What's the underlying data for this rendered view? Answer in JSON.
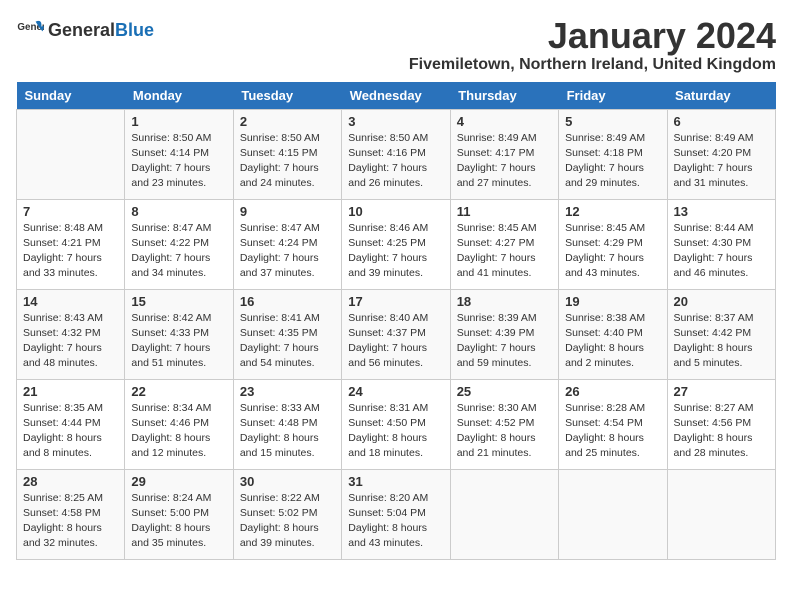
{
  "header": {
    "logo_general": "General",
    "logo_blue": "Blue",
    "month_title": "January 2024",
    "location": "Fivemiletown, Northern Ireland, United Kingdom"
  },
  "days_of_week": [
    "Sunday",
    "Monday",
    "Tuesday",
    "Wednesday",
    "Thursday",
    "Friday",
    "Saturday"
  ],
  "weeks": [
    [
      {
        "day": "",
        "info": ""
      },
      {
        "day": "1",
        "info": "Sunrise: 8:50 AM\nSunset: 4:14 PM\nDaylight: 7 hours\nand 23 minutes."
      },
      {
        "day": "2",
        "info": "Sunrise: 8:50 AM\nSunset: 4:15 PM\nDaylight: 7 hours\nand 24 minutes."
      },
      {
        "day": "3",
        "info": "Sunrise: 8:50 AM\nSunset: 4:16 PM\nDaylight: 7 hours\nand 26 minutes."
      },
      {
        "day": "4",
        "info": "Sunrise: 8:49 AM\nSunset: 4:17 PM\nDaylight: 7 hours\nand 27 minutes."
      },
      {
        "day": "5",
        "info": "Sunrise: 8:49 AM\nSunset: 4:18 PM\nDaylight: 7 hours\nand 29 minutes."
      },
      {
        "day": "6",
        "info": "Sunrise: 8:49 AM\nSunset: 4:20 PM\nDaylight: 7 hours\nand 31 minutes."
      }
    ],
    [
      {
        "day": "7",
        "info": "Sunrise: 8:48 AM\nSunset: 4:21 PM\nDaylight: 7 hours\nand 33 minutes."
      },
      {
        "day": "8",
        "info": "Sunrise: 8:47 AM\nSunset: 4:22 PM\nDaylight: 7 hours\nand 34 minutes."
      },
      {
        "day": "9",
        "info": "Sunrise: 8:47 AM\nSunset: 4:24 PM\nDaylight: 7 hours\nand 37 minutes."
      },
      {
        "day": "10",
        "info": "Sunrise: 8:46 AM\nSunset: 4:25 PM\nDaylight: 7 hours\nand 39 minutes."
      },
      {
        "day": "11",
        "info": "Sunrise: 8:45 AM\nSunset: 4:27 PM\nDaylight: 7 hours\nand 41 minutes."
      },
      {
        "day": "12",
        "info": "Sunrise: 8:45 AM\nSunset: 4:29 PM\nDaylight: 7 hours\nand 43 minutes."
      },
      {
        "day": "13",
        "info": "Sunrise: 8:44 AM\nSunset: 4:30 PM\nDaylight: 7 hours\nand 46 minutes."
      }
    ],
    [
      {
        "day": "14",
        "info": "Sunrise: 8:43 AM\nSunset: 4:32 PM\nDaylight: 7 hours\nand 48 minutes."
      },
      {
        "day": "15",
        "info": "Sunrise: 8:42 AM\nSunset: 4:33 PM\nDaylight: 7 hours\nand 51 minutes."
      },
      {
        "day": "16",
        "info": "Sunrise: 8:41 AM\nSunset: 4:35 PM\nDaylight: 7 hours\nand 54 minutes."
      },
      {
        "day": "17",
        "info": "Sunrise: 8:40 AM\nSunset: 4:37 PM\nDaylight: 7 hours\nand 56 minutes."
      },
      {
        "day": "18",
        "info": "Sunrise: 8:39 AM\nSunset: 4:39 PM\nDaylight: 7 hours\nand 59 minutes."
      },
      {
        "day": "19",
        "info": "Sunrise: 8:38 AM\nSunset: 4:40 PM\nDaylight: 8 hours\nand 2 minutes."
      },
      {
        "day": "20",
        "info": "Sunrise: 8:37 AM\nSunset: 4:42 PM\nDaylight: 8 hours\nand 5 minutes."
      }
    ],
    [
      {
        "day": "21",
        "info": "Sunrise: 8:35 AM\nSunset: 4:44 PM\nDaylight: 8 hours\nand 8 minutes."
      },
      {
        "day": "22",
        "info": "Sunrise: 8:34 AM\nSunset: 4:46 PM\nDaylight: 8 hours\nand 12 minutes."
      },
      {
        "day": "23",
        "info": "Sunrise: 8:33 AM\nSunset: 4:48 PM\nDaylight: 8 hours\nand 15 minutes."
      },
      {
        "day": "24",
        "info": "Sunrise: 8:31 AM\nSunset: 4:50 PM\nDaylight: 8 hours\nand 18 minutes."
      },
      {
        "day": "25",
        "info": "Sunrise: 8:30 AM\nSunset: 4:52 PM\nDaylight: 8 hours\nand 21 minutes."
      },
      {
        "day": "26",
        "info": "Sunrise: 8:28 AM\nSunset: 4:54 PM\nDaylight: 8 hours\nand 25 minutes."
      },
      {
        "day": "27",
        "info": "Sunrise: 8:27 AM\nSunset: 4:56 PM\nDaylight: 8 hours\nand 28 minutes."
      }
    ],
    [
      {
        "day": "28",
        "info": "Sunrise: 8:25 AM\nSunset: 4:58 PM\nDaylight: 8 hours\nand 32 minutes."
      },
      {
        "day": "29",
        "info": "Sunrise: 8:24 AM\nSunset: 5:00 PM\nDaylight: 8 hours\nand 35 minutes."
      },
      {
        "day": "30",
        "info": "Sunrise: 8:22 AM\nSunset: 5:02 PM\nDaylight: 8 hours\nand 39 minutes."
      },
      {
        "day": "31",
        "info": "Sunrise: 8:20 AM\nSunset: 5:04 PM\nDaylight: 8 hours\nand 43 minutes."
      },
      {
        "day": "",
        "info": ""
      },
      {
        "day": "",
        "info": ""
      },
      {
        "day": "",
        "info": ""
      }
    ]
  ]
}
